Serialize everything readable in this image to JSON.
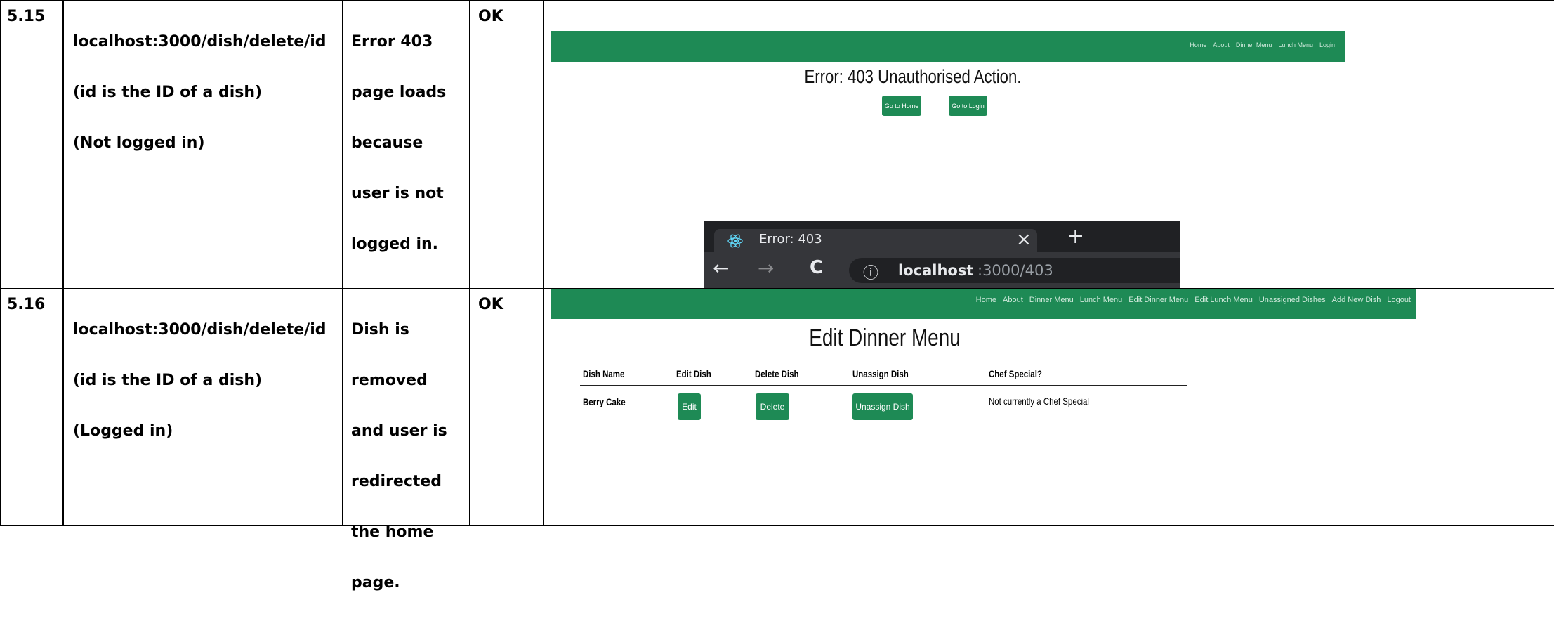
{
  "rows": [
    {
      "number": "5.15",
      "test_lines": [
        "localhost:3000/dish/delete/id",
        "(id is the ID of a dish)",
        "(Not logged in)"
      ],
      "expected_lines": [
        "Error 403",
        "page loads",
        "because",
        "user is not",
        "logged in."
      ],
      "result": "OK"
    },
    {
      "number": "5.16",
      "test_lines": [
        "localhost:3000/dish/delete/id",
        "(id is the ID of a dish)",
        "(Logged in)"
      ],
      "expected_lines": [
        "Dish is",
        "removed",
        "and user is",
        "redirected",
        "the home",
        "page."
      ],
      "result": "OK"
    }
  ],
  "shot403": {
    "nav_links": [
      "Home",
      "About",
      "Dinner Menu",
      "Lunch Menu",
      "Login"
    ],
    "title": "Error: 403 Unauthorised Action.",
    "home_button": "Go to Home",
    "login_button": "Go to Login",
    "tab_title": "Error: 403",
    "tab_close": "×",
    "new_tab": "+",
    "back": "←",
    "forward": "→",
    "reload": "C",
    "info_icon": "ⓘ",
    "url_host": "localhost",
    "url_rest": ":3000/403"
  },
  "shotEdit": {
    "nav_links": [
      "Home",
      "About",
      "Dinner Menu",
      "Lunch Menu",
      "Edit Dinner Menu",
      "Edit Lunch Menu",
      "Unassigned Dishes",
      "Add New Dish",
      "Logout"
    ],
    "title": "Edit Dinner Menu",
    "headers": [
      "Dish Name",
      "Edit Dish",
      "Delete Dish",
      "Unassign Dish",
      "Chef Special?"
    ],
    "row": {
      "dish_name": "Berry Cake",
      "edit_button": "Edit",
      "delete_button": "Delete",
      "unassign_button": "Unassign Dish",
      "chef_special": "Not currently a Chef Special"
    }
  },
  "colors": {
    "nav_green": "#1e8a55",
    "browser_dark": "#202124",
    "browser_tab": "#35363a"
  }
}
